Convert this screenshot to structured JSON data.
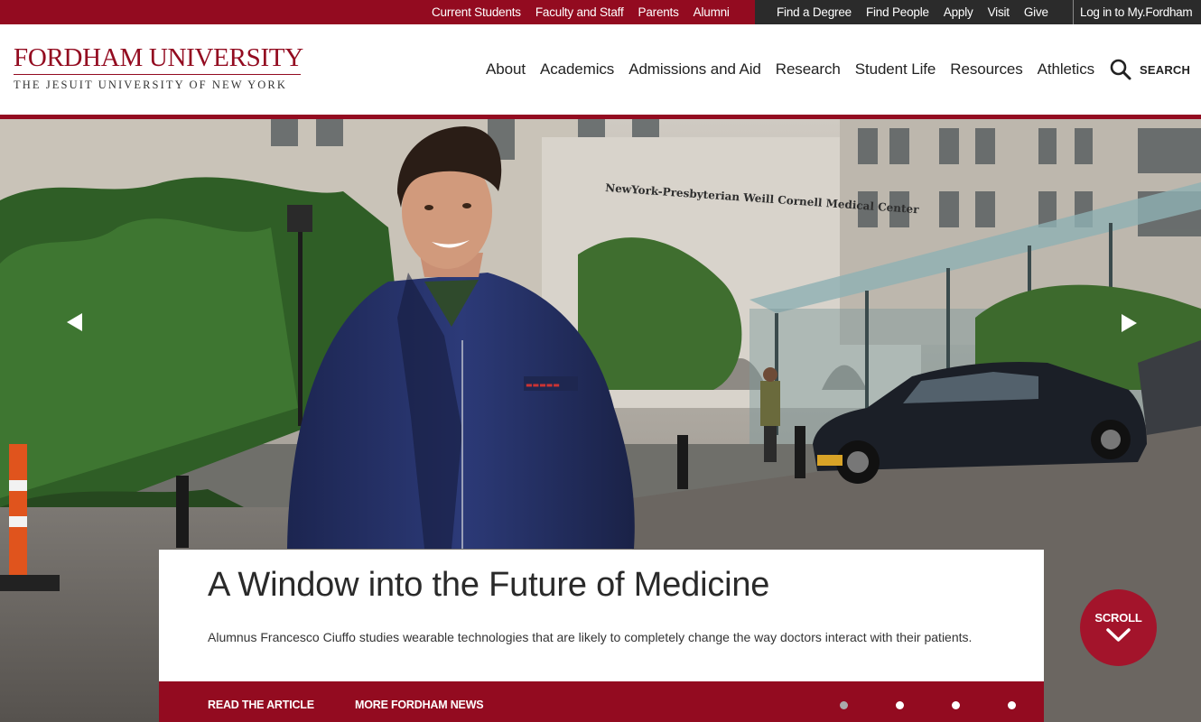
{
  "utility": {
    "left_links": [
      "Current Students",
      "Faculty and Staff",
      "Parents",
      "Alumni"
    ],
    "right_links": [
      "Find a Degree",
      "Find People",
      "Apply",
      "Visit",
      "Give"
    ],
    "login": "Log in to My.Fordham"
  },
  "brand": {
    "title": "FORDHAM UNIVERSITY",
    "tagline": "THE JESUIT UNIVERSITY OF NEW YORK",
    "color": "#930b20"
  },
  "nav": {
    "items": [
      "About",
      "Academics",
      "Admissions and Aid",
      "Research",
      "Student Life",
      "Resources",
      "Athletics"
    ],
    "search_label": "SEARCH",
    "search_icon": "search-icon"
  },
  "hero": {
    "signage": "NewYork-Presbyterian Weill Cornell Medical Center",
    "prev_icon": "triangle-left-icon",
    "next_icon": "triangle-right-icon"
  },
  "caption": {
    "title": "A Window into the Future of Medicine",
    "text": "Alumnus Francesco Ciuffo studies wearable technologies that are likely to completely change the way doctors interact with their patients.",
    "read_link": "READ THE ARTICLE",
    "news_link": "MORE FORDHAM NEWS",
    "slides": [
      true,
      false,
      false,
      false
    ]
  },
  "scroll": {
    "label": "SCROLL",
    "icon": "chevron-down-icon"
  }
}
